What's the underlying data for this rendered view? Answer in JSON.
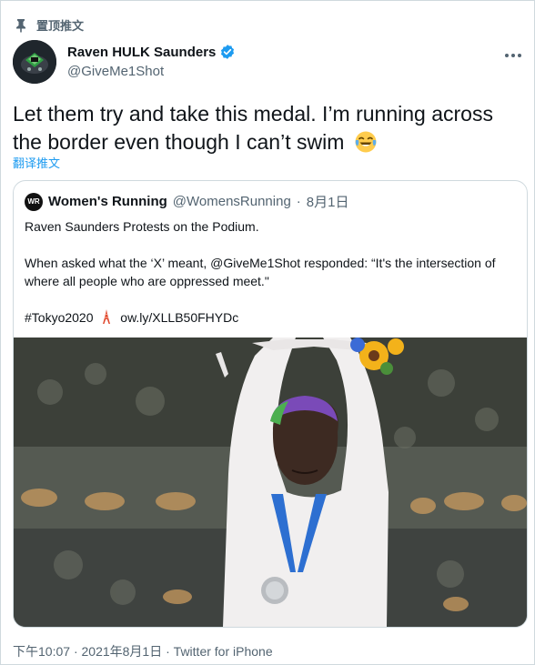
{
  "pinned": {
    "label": "置顶推文"
  },
  "author": {
    "name": "Raven HULK Saunders",
    "handle": "@GiveMe1Shot"
  },
  "tweet": {
    "text": "Let them try and take this medal. I’m running across the border even though I can’t swim",
    "emoji": "face-with-tears-of-joy",
    "translate_label": "翻译推文"
  },
  "quoted": {
    "avatar_text": "WR",
    "name": "Women's Running",
    "handle": "@WomensRunning",
    "separator": "·",
    "date": "8月1日",
    "line1": "Raven Saunders Protests on the Podium.",
    "line2": "When asked what the ‘X’ meant, @GiveMe1Shot responded: “It's the intersection of where all people who are oppressed meet.\"",
    "hashtag": "#Tokyo2020",
    "link": "ow.ly/XLLB50FHYDc"
  },
  "footer": {
    "time": "下午10:07",
    "dot1": "·",
    "date": "2021年8月1日",
    "dot2": "·",
    "source": "Twitter for iPhone"
  },
  "colors": {
    "accent": "#1d9bf0",
    "muted": "#536471",
    "border": "#cfd9de",
    "text": "#0f1419"
  }
}
